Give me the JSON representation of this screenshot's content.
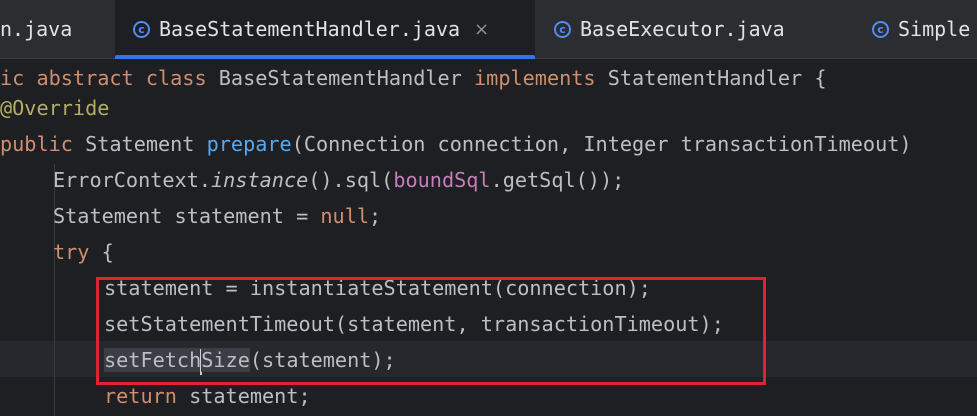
{
  "tabs": [
    {
      "label": "n.java",
      "icon": "class-icon"
    },
    {
      "label": "BaseStatementHandler.java",
      "icon": "class-icon",
      "active": true,
      "close": "×"
    },
    {
      "label": "BaseExecutor.java",
      "icon": "class-icon"
    },
    {
      "label": "Simple",
      "icon": "class-icon"
    }
  ],
  "code": {
    "l1": {
      "kw1": "ic abstract class ",
      "name": "BaseStatementHandler ",
      "kw2": "implements ",
      "rest": "StatementHandler {"
    },
    "l2": {
      "annotation": "@Override"
    },
    "l3": {
      "kw": "public ",
      "type": "Statement ",
      "method": "prepare",
      "rest": "(Connection connection, Integer transactionTimeout)"
    },
    "l4": {
      "a": "ErrorContext.",
      "b": "instance",
      "c": "().sql(",
      "d": "boundSql",
      "e": ".getSql());"
    },
    "l5": {
      "a": "Statement statement = ",
      "b": "null",
      "c": ";"
    },
    "l6": {
      "kw": "try",
      "rest": " {"
    },
    "l7": "statement = instantiateStatement(connection);",
    "l8": "setStatementTimeout(statement, transactionTimeout);",
    "l9": {
      "a": "setFetch",
      "b": "Size",
      "c": "(statement);"
    },
    "l10": {
      "kw": "return",
      "rest": " statement;"
    }
  },
  "colors": {
    "keyword": "#cf8e6d",
    "annotation": "#b3ae60",
    "method": "#56a8f5",
    "field": "#c77dbb",
    "highlight_box": "#e0242f",
    "tab_accent": "#3574f0"
  }
}
